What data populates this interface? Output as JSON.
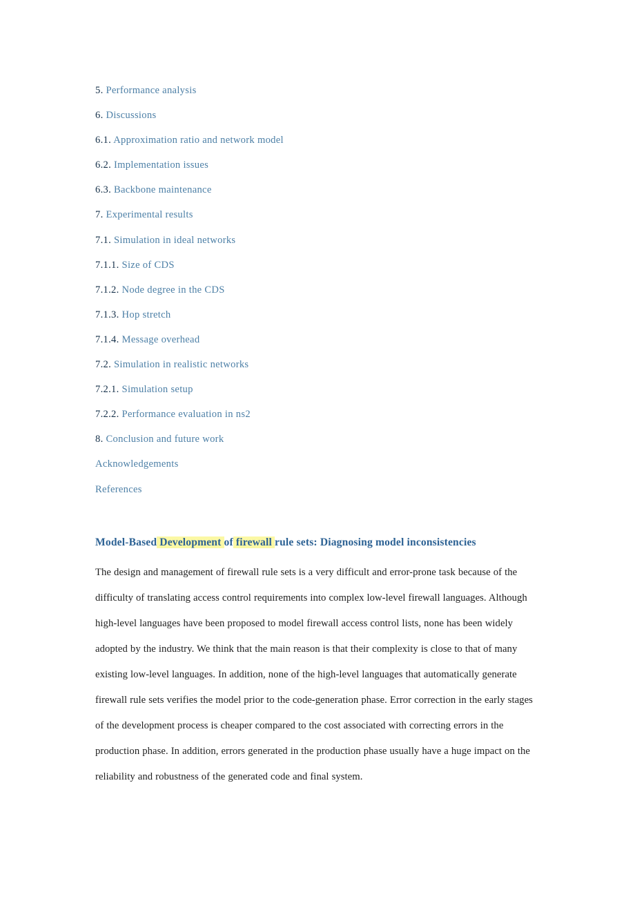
{
  "document": {
    "background_color": "#ffffff",
    "link_color": "#4c7fa6",
    "number_color": "#16314a",
    "title_color": "#2d6294",
    "body_color": "#1d1d1d",
    "highlight_color": "#fbf8a4"
  },
  "toc": {
    "entries": [
      {
        "number": "5.",
        "label": "Performance analysis"
      },
      {
        "number": "6.",
        "label": "Discussions"
      },
      {
        "number": "6.1.",
        "label": "Approximation ratio and network model"
      },
      {
        "number": "6.2.",
        "label": "Implementation issues"
      },
      {
        "number": "6.3.",
        "label": "Backbone maintenance"
      },
      {
        "number": "7.",
        "label": "Experimental results"
      },
      {
        "number": "7.1.",
        "label": "Simulation in ideal networks"
      },
      {
        "number": "7.1.1.",
        "label": "Size of CDS"
      },
      {
        "number": "7.1.2.",
        "label": "Node degree in the CDS"
      },
      {
        "number": "7.1.3.",
        "label": "Hop stretch"
      },
      {
        "number": "7.1.4.",
        "label": "Message overhead"
      },
      {
        "number": "7.2.",
        "label": "Simulation in realistic networks"
      },
      {
        "number": "7.2.1.",
        "label": "Simulation setup"
      },
      {
        "number": "7.2.2.",
        "label": "Performance evaluation in ns2"
      },
      {
        "number": "8.",
        "label": "Conclusion and future work"
      },
      {
        "number": "",
        "label": "Acknowledgements"
      },
      {
        "number": "",
        "label": "References"
      }
    ]
  },
  "article": {
    "title_parts": [
      {
        "text": "Model-Based",
        "highlighted": false
      },
      {
        "text": " Development ",
        "highlighted": true
      },
      {
        "text": "of",
        "highlighted": false
      },
      {
        "text": " firewall ",
        "highlighted": true
      },
      {
        "text": "rule sets: Diagnosing model inconsistencies",
        "highlighted": false
      }
    ],
    "title_plain": "Model-Based Development of firewall rule sets: Diagnosing model inconsistencies",
    "abstract": "The design and management of firewall rule sets is a very difficult and error-prone task because of the difficulty of translating access control requirements into complex low-level firewall languages. Although high-level languages have been proposed to model firewall access control lists, none has been widely adopted by the industry. We think that the main reason is that their complexity is close to that of many existing low-level languages. In addition, none of the high-level languages that automatically generate firewall rule sets verifies the model prior to the code-generation phase. Error correction in the early stages of the development process is cheaper compared to the cost associated with correcting errors in the production phase. In addition, errors generated in the production phase usually have a huge impact on the reliability and robustness of the generated code and final system."
  }
}
